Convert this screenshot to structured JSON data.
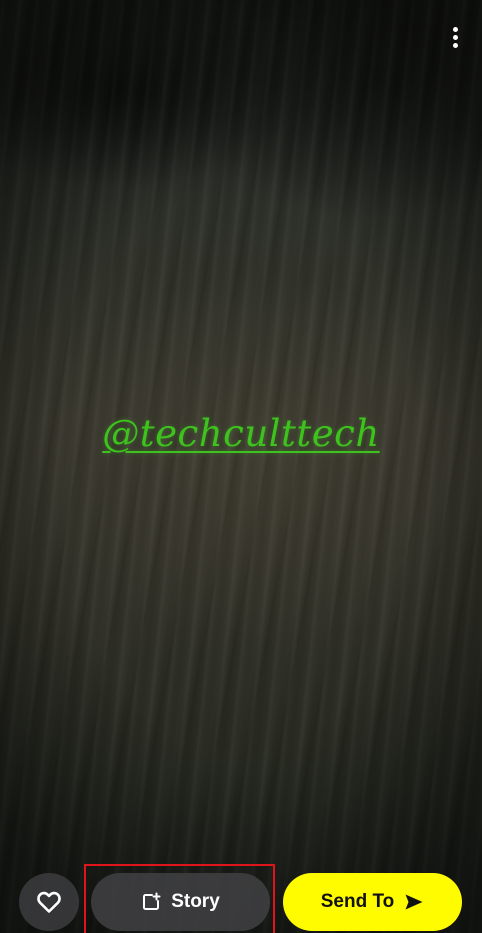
{
  "media": {
    "caption": "@techculttech",
    "caption_color": "#3ec21e"
  },
  "top_bar": {
    "more_icon": "more-vertical-icon"
  },
  "bottom_bar": {
    "favorite_icon": "heart-icon",
    "story_label": "Story",
    "story_icon": "add-story-icon",
    "send_label": "Send To",
    "send_icon": "send-arrow-icon",
    "send_color": "#fffc00",
    "highlight_color": "#e0141b"
  }
}
